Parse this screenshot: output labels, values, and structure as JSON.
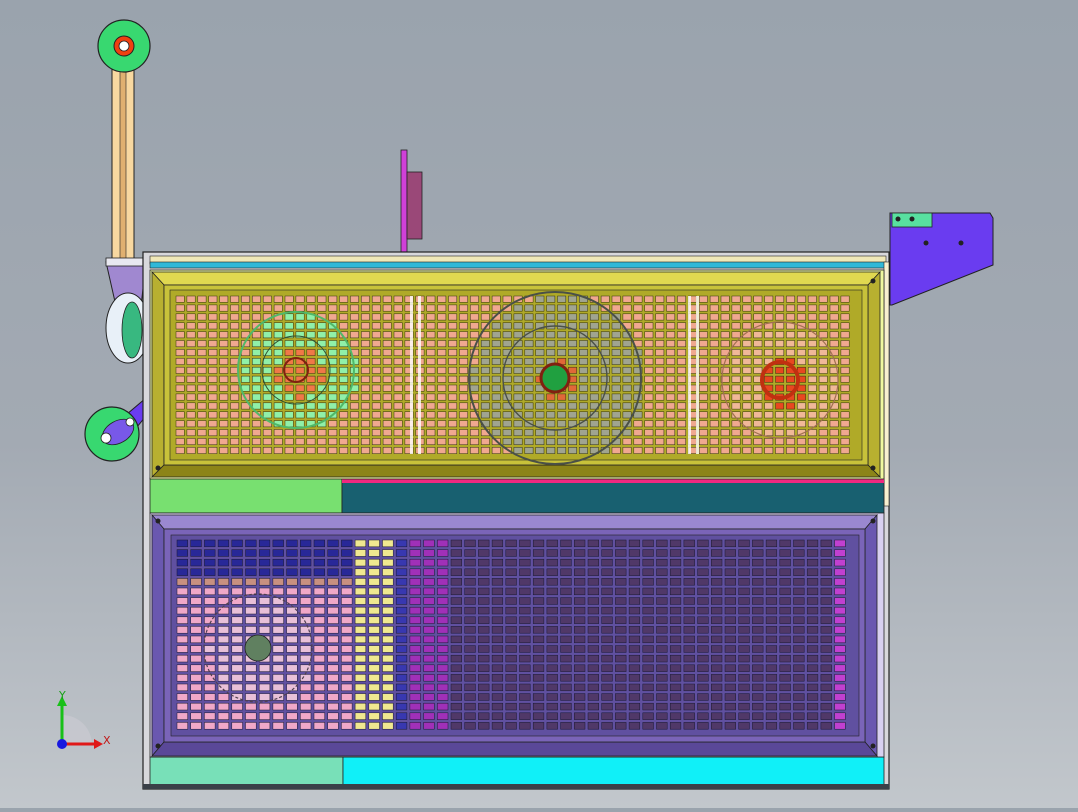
{
  "viewport": {
    "background_top": "#9aa3ad",
    "background_bottom": "#c2c7cc"
  },
  "triad": {
    "x_label": "X",
    "y_label": "Y",
    "x_color": "#e01818",
    "y_color": "#18c018",
    "z_color": "#1818e0"
  },
  "colors": {
    "top_grille_frame": "#c8c23a",
    "top_grille_cells": "#f0a890",
    "bottom_grille_frame": "#7a64b8",
    "bottom_grille_cells_left": "#f0a8c8",
    "bottom_grille_cells_mid": "#f0e890",
    "bottom_grille_cells_right": "#9050a0",
    "fan_green": "#70e090",
    "fan_gray": "#808878",
    "fan_red": "#d04020",
    "bracket_purple": "#6a3cf0",
    "wheel_green": "#38d870",
    "panel_green": "#78e070",
    "panel_teal": "#186070",
    "panel_cyan": "#10f0f8",
    "panel_mint": "#78e0b8"
  }
}
